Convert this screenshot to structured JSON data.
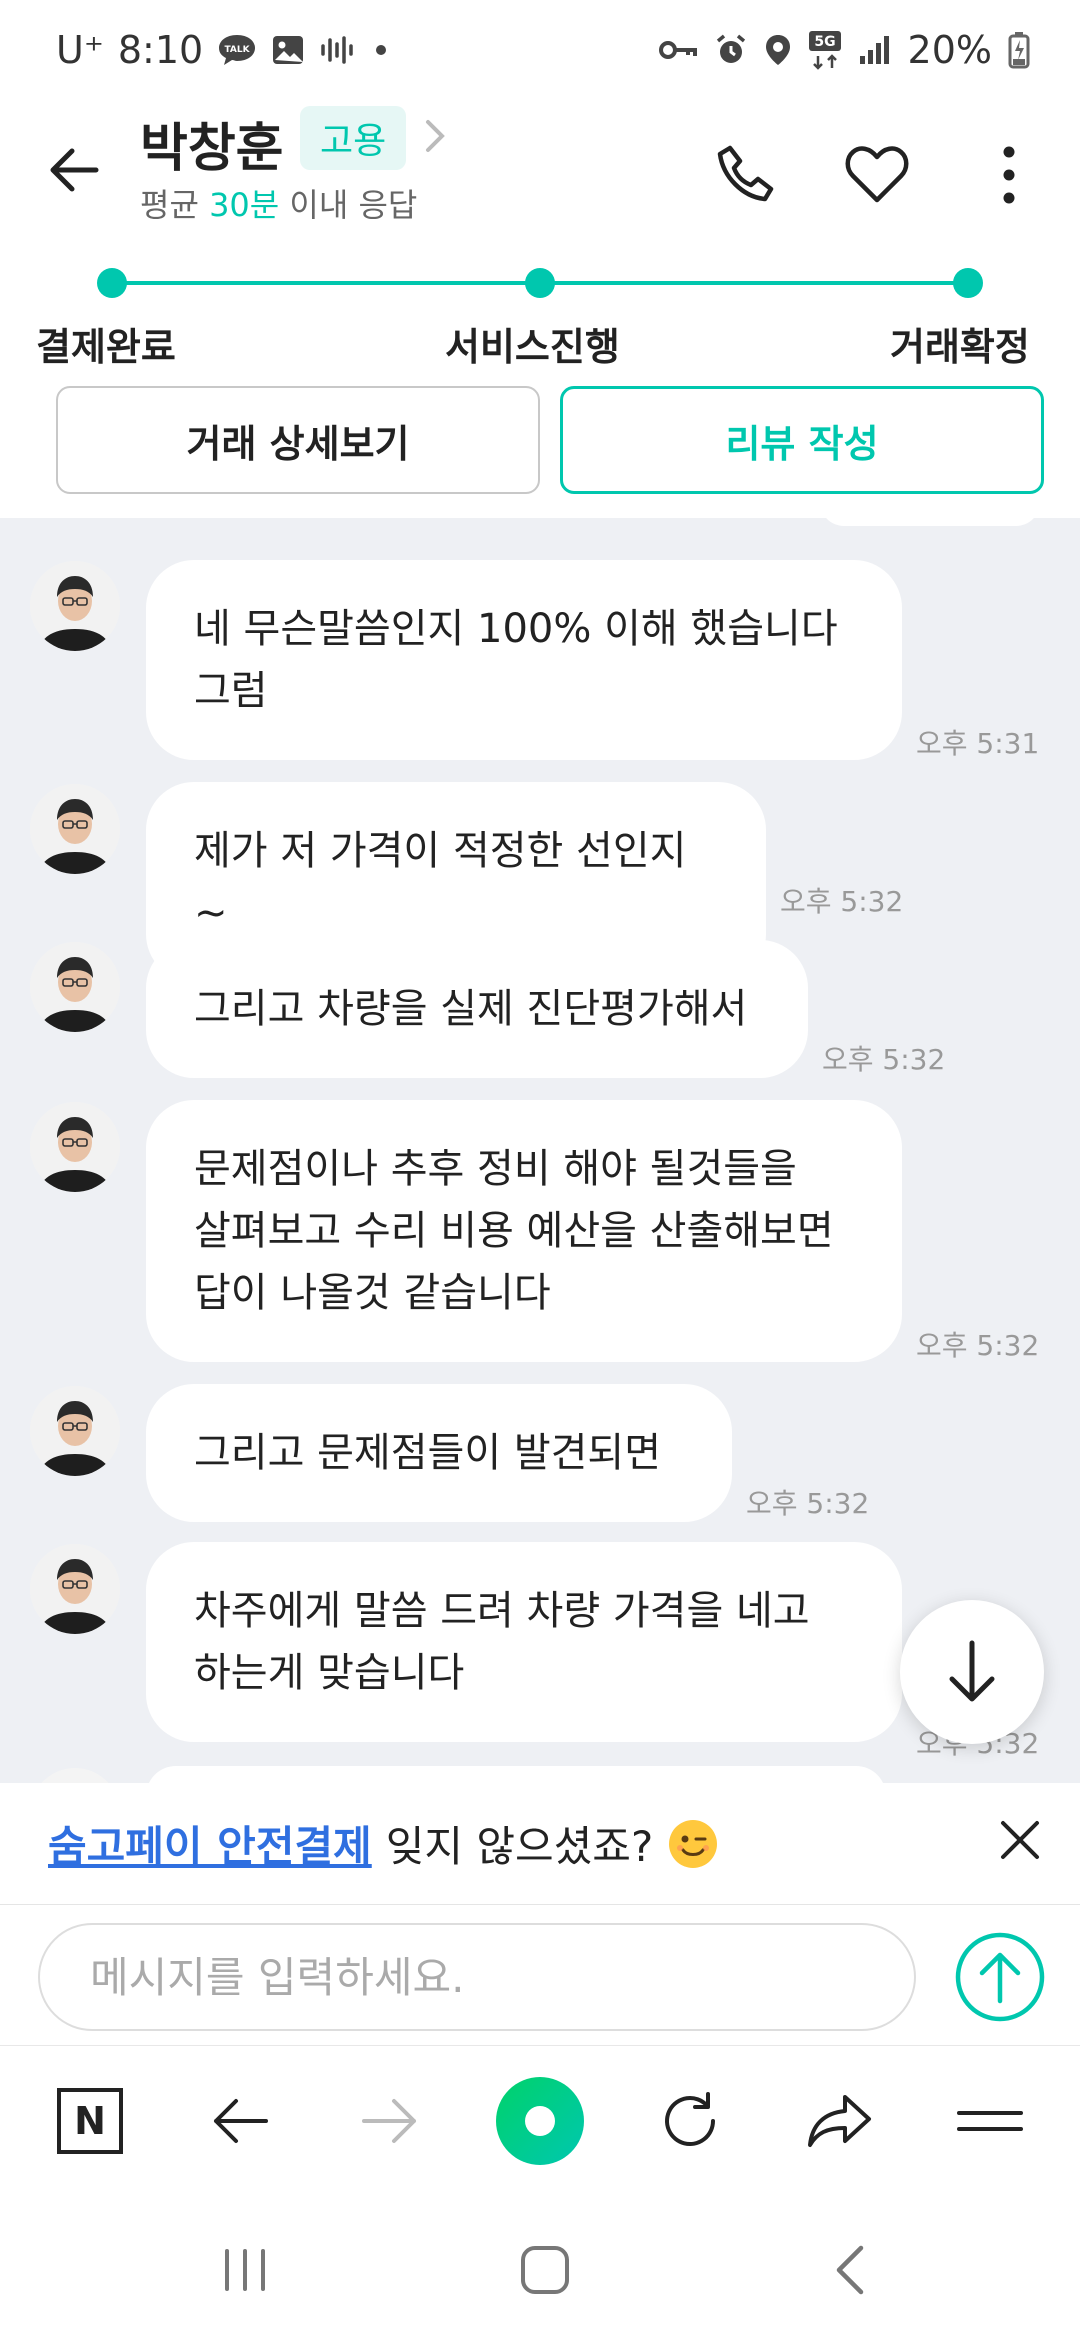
{
  "status_bar": {
    "carrier": "U⁺",
    "time": "8:10",
    "talk_label": "TALK",
    "network": "5G",
    "battery": "20%"
  },
  "header": {
    "name": "박창훈",
    "badge": "고용",
    "response_prefix": "평균 ",
    "response_highlight": "30분",
    "response_suffix": " 이내 응답"
  },
  "progress": {
    "steps": [
      "결제완료",
      "서비스진행",
      "거래확정"
    ],
    "accent": "#00c7ae"
  },
  "actions": {
    "detail_label": "거래 상세보기",
    "review_label": "리뷰 작성"
  },
  "messages": [
    {
      "lines": [
        "네 무슨말씀인지 100% 이해 했습니다",
        "그럼"
      ],
      "time": "오후 5:31"
    },
    {
      "lines": [
        "제가 저 가격이 적정한 선인지~"
      ],
      "time": "오후 5:32"
    },
    {
      "lines": [
        "그리고 차량을 실제 진단평가해서"
      ],
      "time": "오후 5:32"
    },
    {
      "lines": [
        "문제점이나 추후 정비 해야 될것들을",
        "살펴보고 수리 비용 예산을 산출해보면",
        "답이 나올것 같습니다"
      ],
      "time": "오후 5:32"
    },
    {
      "lines": [
        "그리고 문제점들이 발견되면"
      ],
      "time": "오후 5:32"
    },
    {
      "lines": [
        "차주에게 말씀 드려 차량 가격을 네고",
        "하는게 맞습니다"
      ],
      "time": "오후 5:32"
    }
  ],
  "banner": {
    "link": "숨고페이 안전결제",
    "text": "잊지 않으셨죠?"
  },
  "composer": {
    "placeholder": "메시지를 입력하세요."
  },
  "toolbar": {
    "n_label": "N"
  }
}
